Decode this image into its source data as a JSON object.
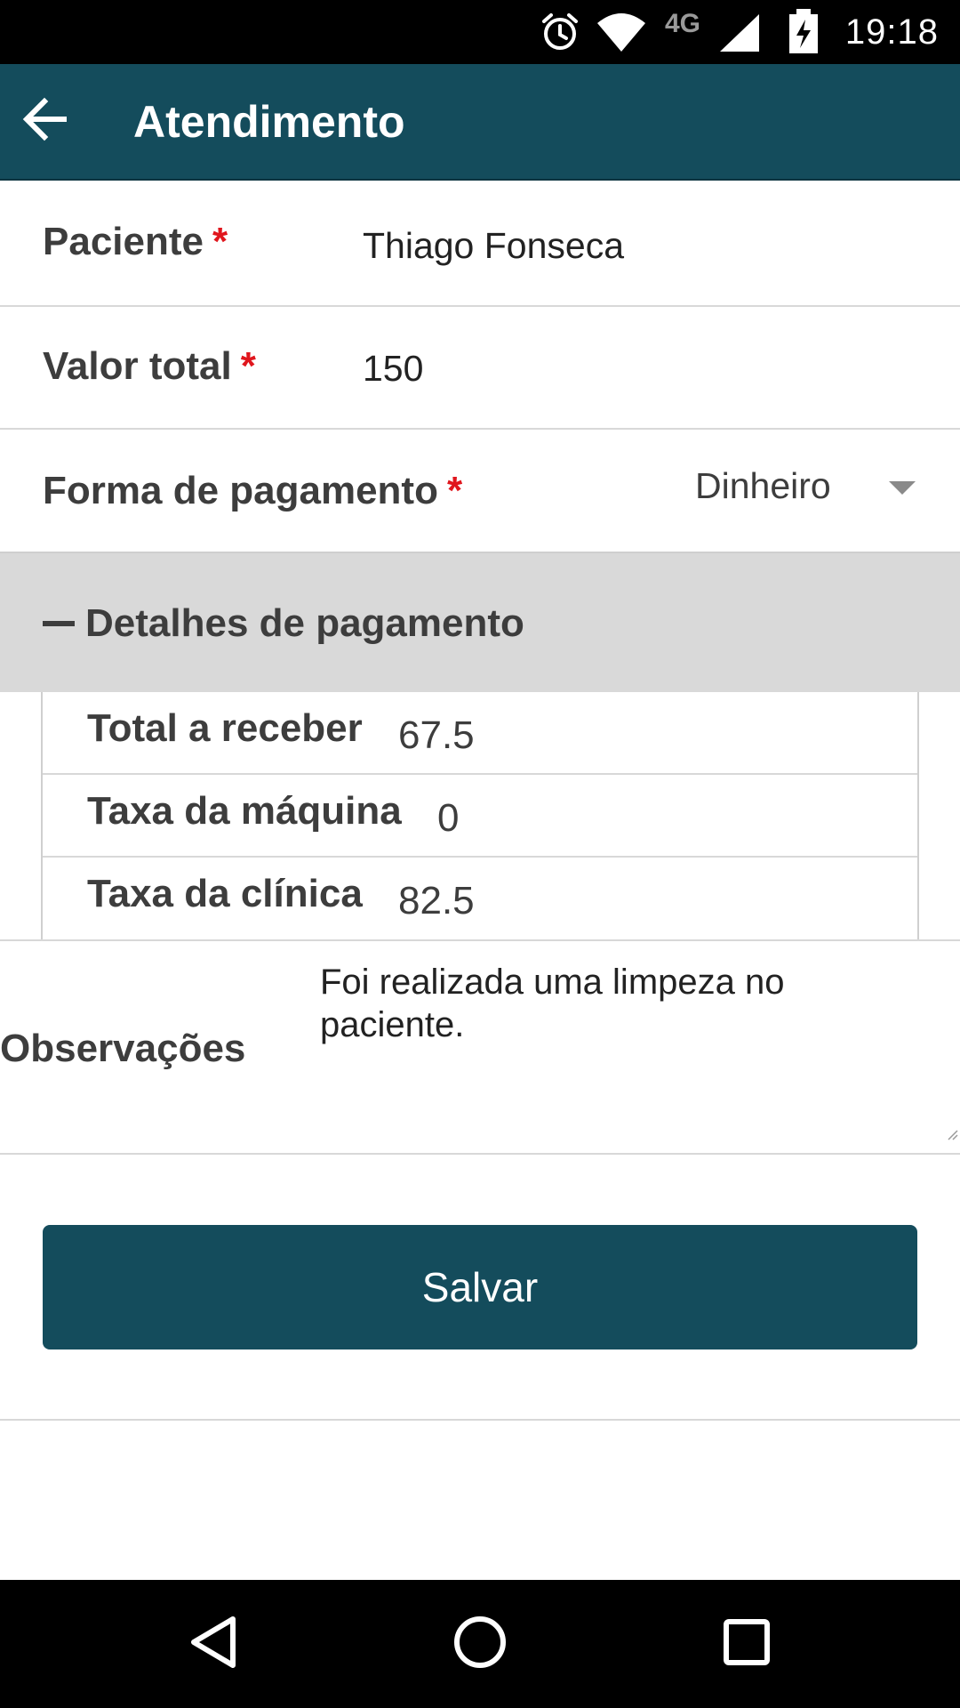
{
  "status_bar": {
    "time": "19:18",
    "network": "4G",
    "icons": [
      "alarm-icon",
      "wifi-icon",
      "signal-icon",
      "battery-charging-icon"
    ]
  },
  "app_bar": {
    "title": "Atendimento",
    "back_icon": "arrow-left-icon"
  },
  "form": {
    "patient": {
      "label": "Paciente",
      "required_mark": "*",
      "value": "Thiago Fonseca"
    },
    "total": {
      "label": "Valor total",
      "required_mark": "*",
      "value": "150"
    },
    "payment": {
      "label": "Forma de pagamento",
      "required_mark": "*",
      "selected": "Dinheiro"
    }
  },
  "details": {
    "header": "Detalhes de pagamento",
    "collapse_icon": "minus-icon",
    "rows": [
      {
        "label": "Total a receber",
        "value": "67.5"
      },
      {
        "label": "Taxa da máquina",
        "value": "0"
      },
      {
        "label": "Taxa da clínica",
        "value": "82.5"
      }
    ]
  },
  "notes": {
    "label": "Observações",
    "value": "Foi realizada uma limpeza no paciente."
  },
  "actions": {
    "save_label": "Salvar"
  },
  "colors": {
    "primary": "#144c5c",
    "required": "#e0161d",
    "section_bg": "#d9d9d9"
  },
  "nav_bar": {
    "icons": [
      "back-triangle-icon",
      "home-circle-icon",
      "recents-square-icon"
    ]
  }
}
